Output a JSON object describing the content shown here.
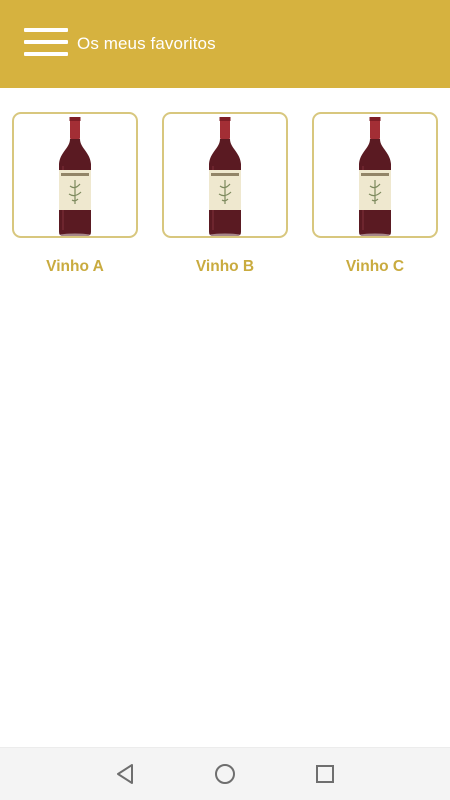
{
  "app_bar": {
    "title": "Os meus favoritos",
    "menu_icon": "hamburger-menu-icon",
    "color": "#d6b23f"
  },
  "favorites": [
    {
      "name": "Vinho A",
      "image": "red-wine-bottle"
    },
    {
      "name": "Vinho B",
      "image": "red-wine-bottle"
    },
    {
      "name": "Vinho C",
      "image": "red-wine-bottle"
    }
  ],
  "colors": {
    "accent": "#c9ab3f",
    "card_border": "#d8c77e",
    "bottle": "#5a1a22"
  },
  "nav_bar": {
    "back_icon": "back-triangle-icon",
    "home_icon": "home-circle-icon",
    "recent_icon": "recent-apps-square-icon"
  }
}
